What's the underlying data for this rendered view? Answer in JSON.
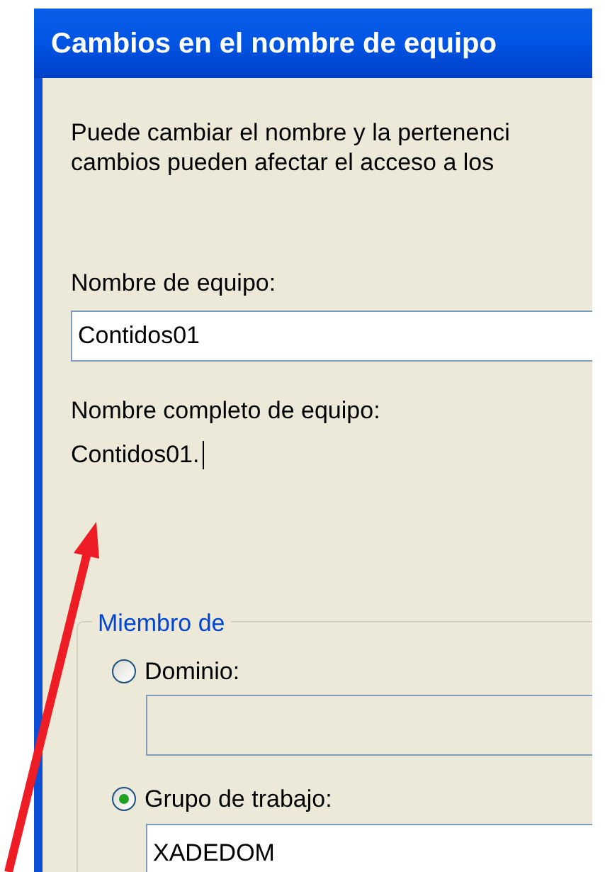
{
  "window": {
    "title": "Cambios en el nombre de equipo"
  },
  "description": [
    "Puede cambiar el nombre y la pertenenci",
    "cambios pueden afectar el acceso a los"
  ],
  "computer_name": {
    "label": "Nombre de equipo:",
    "value": "Contidos01"
  },
  "full_name": {
    "label": "Nombre completo de equipo:",
    "value": "Contidos01.",
    "cursor": true
  },
  "member_of": {
    "title": "Miembro de",
    "options": [
      {
        "label": "Dominio:",
        "selected": false,
        "field": {
          "disabled": true
        }
      },
      {
        "label": "Grupo de trabajo:",
        "selected": true,
        "field": {
          "value": "XADEDOM",
          "disabled": false
        }
      }
    ]
  }
}
